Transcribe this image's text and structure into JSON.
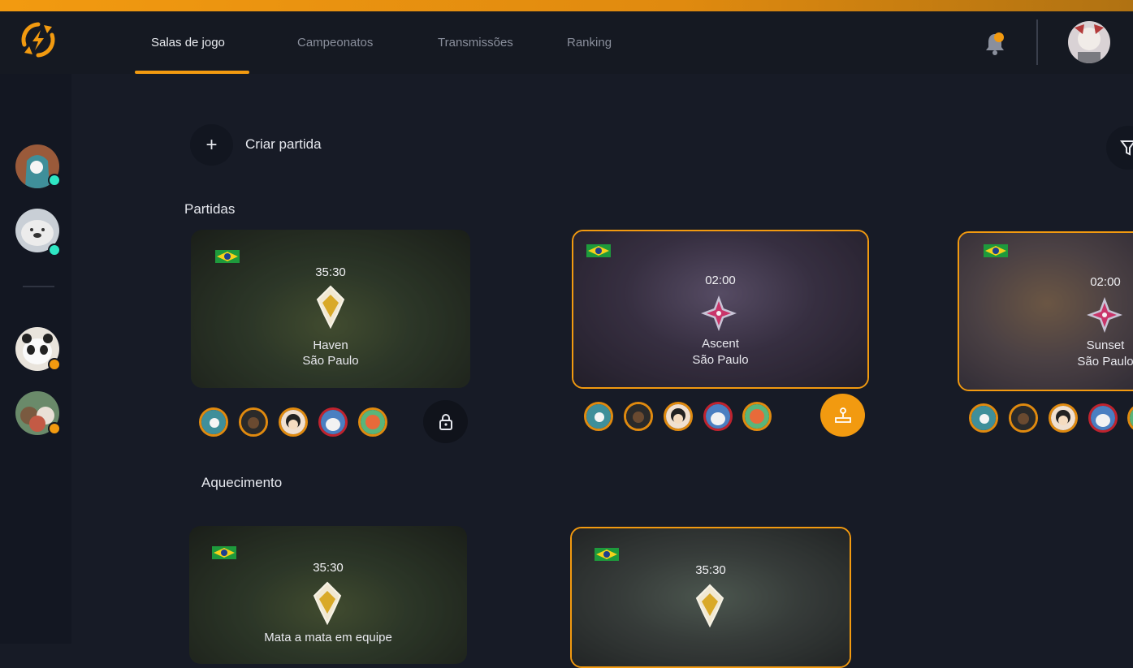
{
  "nav": {
    "tabs": [
      {
        "label": "Salas de jogo",
        "active": true
      },
      {
        "label": "Campeonatos",
        "active": false
      },
      {
        "label": "Transmissões",
        "active": false
      },
      {
        "label": "Ranking",
        "active": false
      }
    ]
  },
  "header": {
    "logo_icon": "refresh-lightning-logo",
    "notification_icon": "bell-icon",
    "notification_indicator": true,
    "profile_avatar": "user-avatar"
  },
  "sidebar": {
    "friends": [
      {
        "status": "online",
        "status_color": "#2ee6c4"
      },
      {
        "status": "online",
        "status_color": "#2ee6c4"
      },
      {
        "status": "away",
        "status_color": "#f29a10"
      },
      {
        "status": "away",
        "status_color": "#f29a10"
      }
    ]
  },
  "actions": {
    "create_label": "Criar partida",
    "create_icon": "plus-icon",
    "filter_icon": "filter-icon"
  },
  "sections": {
    "matches_title": "Partidas",
    "warmup_title": "Aquecimento"
  },
  "matches": [
    {
      "timer": "35:30",
      "map": "Haven",
      "city": "São Paulo",
      "rank_icon": "gold-rank-icon",
      "action": "lock",
      "highlighted": false
    },
    {
      "timer": "02:00",
      "map": "Ascent",
      "city": "São Paulo",
      "rank_icon": "diamond-rank-icon",
      "action": "join",
      "highlighted": true
    },
    {
      "timer": "02:00",
      "map": "Sunset",
      "city": "São Paulo",
      "rank_icon": "diamond-rank-icon",
      "action": "",
      "highlighted": true
    }
  ],
  "warmups": [
    {
      "timer": "35:30",
      "map": "Mata a mata em equipe",
      "rank_icon": "gold-rank-icon",
      "highlighted": false
    },
    {
      "timer": "35:30",
      "map": "",
      "rank_icon": "gold-rank-icon",
      "highlighted": true
    }
  ],
  "colors": {
    "accent": "#f29a10",
    "background": "#171b26",
    "online": "#2ee6c4",
    "red_border": "#c0232e"
  }
}
